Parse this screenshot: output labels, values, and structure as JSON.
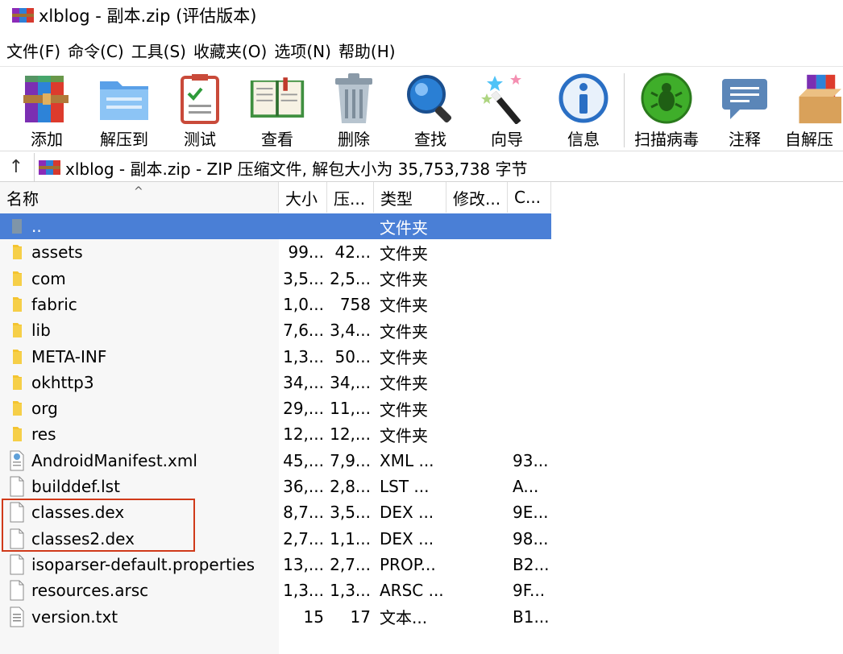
{
  "window": {
    "title": "xlblog - 副本.zip (评估版本)",
    "app_icon": "winrar-icon"
  },
  "menu": [
    "文件(F)",
    "命令(C)",
    "工具(S)",
    "收藏夹(O)",
    "选项(N)",
    "帮助(H)"
  ],
  "toolbar": [
    {
      "label": "添加",
      "icon": "add-archive-icon"
    },
    {
      "label": "解压到",
      "icon": "extract-to-icon"
    },
    {
      "label": "测试",
      "icon": "test-icon"
    },
    {
      "label": "查看",
      "icon": "view-icon"
    },
    {
      "label": "删除",
      "icon": "delete-icon"
    },
    {
      "label": "查找",
      "icon": "find-icon"
    },
    {
      "label": "向导",
      "icon": "wizard-icon"
    },
    {
      "label": "信息",
      "icon": "info-icon"
    },
    {
      "label": "扫描病毒",
      "icon": "scan-virus-icon"
    },
    {
      "label": "注释",
      "icon": "comment-icon"
    },
    {
      "label": "自解压",
      "icon": "sfx-icon"
    }
  ],
  "address": {
    "text": "xlblog - 副本.zip - ZIP 压缩文件, 解包大小为 35,753,738 字节"
  },
  "columns": {
    "name": "名称",
    "size": "大小",
    "packed": "压...",
    "type": "类型",
    "modified": "修改...",
    "crc": "C..."
  },
  "files": [
    {
      "name": "..",
      "size": "",
      "packed": "",
      "type": "文件夹",
      "modified": "",
      "crc": "",
      "kind": "parent"
    },
    {
      "name": "assets",
      "size": "99...",
      "packed": "42...",
      "type": "文件夹",
      "modified": "",
      "crc": "",
      "kind": "folder"
    },
    {
      "name": "com",
      "size": "3,5...",
      "packed": "2,5...",
      "type": "文件夹",
      "modified": "",
      "crc": "",
      "kind": "folder"
    },
    {
      "name": "fabric",
      "size": "1,0...",
      "packed": "758",
      "type": "文件夹",
      "modified": "",
      "crc": "",
      "kind": "folder"
    },
    {
      "name": "lib",
      "size": "7,6...",
      "packed": "3,4...",
      "type": "文件夹",
      "modified": "",
      "crc": "",
      "kind": "folder"
    },
    {
      "name": "META-INF",
      "size": "1,3...",
      "packed": "50...",
      "type": "文件夹",
      "modified": "",
      "crc": "",
      "kind": "folder"
    },
    {
      "name": "okhttp3",
      "size": "34,...",
      "packed": "34,...",
      "type": "文件夹",
      "modified": "",
      "crc": "",
      "kind": "folder"
    },
    {
      "name": "org",
      "size": "29,...",
      "packed": "11,...",
      "type": "文件夹",
      "modified": "",
      "crc": "",
      "kind": "folder"
    },
    {
      "name": "res",
      "size": "12,...",
      "packed": "12,...",
      "type": "文件夹",
      "modified": "",
      "crc": "",
      "kind": "folder"
    },
    {
      "name": "AndroidManifest.xml",
      "size": "45,...",
      "packed": "7,9...",
      "type": "XML ...",
      "modified": "",
      "crc": "93...",
      "kind": "xml"
    },
    {
      "name": "builddef.lst",
      "size": "36,...",
      "packed": "2,8...",
      "type": "LST ...",
      "modified": "",
      "crc": "A...",
      "kind": "file"
    },
    {
      "name": "classes.dex",
      "size": "8,7...",
      "packed": "3,5...",
      "type": "DEX ...",
      "modified": "",
      "crc": "9E...",
      "kind": "file"
    },
    {
      "name": "classes2.dex",
      "size": "2,7...",
      "packed": "1,1...",
      "type": "DEX ...",
      "modified": "",
      "crc": "98...",
      "kind": "file"
    },
    {
      "name": "isoparser-default.properties",
      "size": "13,...",
      "packed": "2,7...",
      "type": "PROP...",
      "modified": "",
      "crc": "B2...",
      "kind": "file"
    },
    {
      "name": "resources.arsc",
      "size": "1,3...",
      "packed": "1,3...",
      "type": "ARSC ...",
      "modified": "",
      "crc": "9F...",
      "kind": "file"
    },
    {
      "name": "version.txt",
      "size": "15",
      "packed": "17",
      "type": "文本...",
      "modified": "",
      "crc": "B1...",
      "kind": "text"
    }
  ],
  "colors": {
    "selection": "#4a7fd6",
    "highlight_box": "#d03a1a",
    "folder": "#f4c430"
  }
}
